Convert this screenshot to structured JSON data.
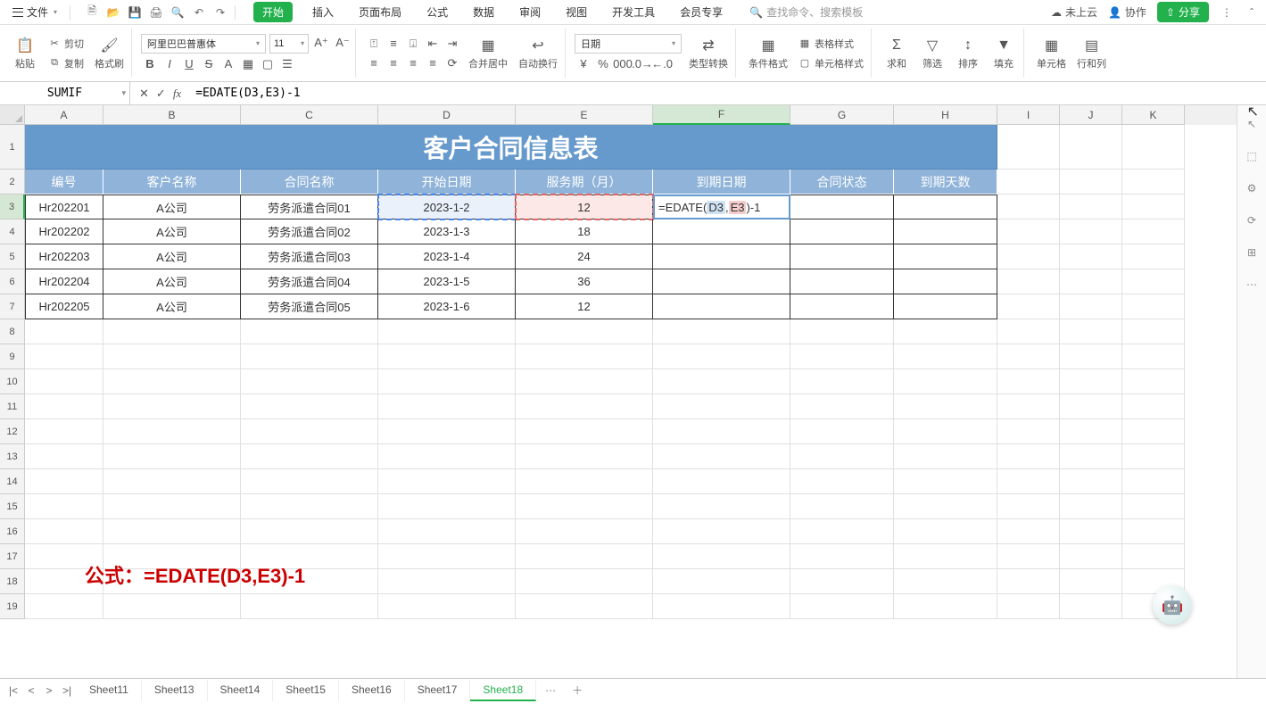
{
  "menu": {
    "file": "文件",
    "tabs": [
      "开始",
      "插入",
      "页面布局",
      "公式",
      "数据",
      "审阅",
      "视图",
      "开发工具",
      "会员专享"
    ],
    "search_placeholder": "查找命令、搜索模板",
    "cloud": "未上云",
    "collab": "协作",
    "share": "分享"
  },
  "ribbon": {
    "paste": "粘贴",
    "cut": "剪切",
    "copy": "复制",
    "format_painter": "格式刷",
    "font_name": "阿里巴巴普惠体",
    "font_size": "11",
    "merge": "合并居中",
    "wrap": "自动换行",
    "number_format": "日期",
    "type_convert": "类型转换",
    "cond_format": "条件格式",
    "table_style": "表格样式",
    "cell_style": "单元格样式",
    "sum": "求和",
    "filter": "筛选",
    "sort": "排序",
    "fill": "填充",
    "cells": "单元格",
    "rowcol": "行和列"
  },
  "formula_bar": {
    "namebox": "SUMIF",
    "formula": "=EDATE(D3,E3)-1"
  },
  "columns": [
    "A",
    "B",
    "C",
    "D",
    "E",
    "F",
    "G",
    "H",
    "I",
    "J",
    "K"
  ],
  "active_col": "F",
  "active_row": "3",
  "table": {
    "title": "客户合同信息表",
    "headers": [
      "编号",
      "客户名称",
      "合同名称",
      "开始日期",
      "服务期（月）",
      "到期日期",
      "合同状态",
      "到期天数"
    ],
    "rows": [
      [
        "Hr202201",
        "A公司",
        "劳务派遣合同01",
        "2023-1-2",
        "12",
        "",
        "",
        ""
      ],
      [
        "Hr202202",
        "A公司",
        "劳务派遣合同02",
        "2023-1-3",
        "18",
        "",
        "",
        ""
      ],
      [
        "Hr202203",
        "A公司",
        "劳务派遣合同03",
        "2023-1-4",
        "24",
        "",
        "",
        ""
      ],
      [
        "Hr202204",
        "A公司",
        "劳务派遣合同04",
        "2023-1-5",
        "36",
        "",
        "",
        ""
      ],
      [
        "Hr202205",
        "A公司",
        "劳务派遣合同05",
        "2023-1-6",
        "12",
        "",
        "",
        ""
      ]
    ],
    "editing_tokens": {
      "prefix": "=EDATE(",
      "d3": "D3",
      "mid": " , ",
      "e3": "E3",
      "suffix": ")-1"
    }
  },
  "formula_note": "公式：=EDATE(D3,E3)-1",
  "sheets": [
    "Sheet11",
    "Sheet13",
    "Sheet14",
    "Sheet15",
    "Sheet16",
    "Sheet17",
    "Sheet18"
  ],
  "active_sheet": "Sheet18"
}
